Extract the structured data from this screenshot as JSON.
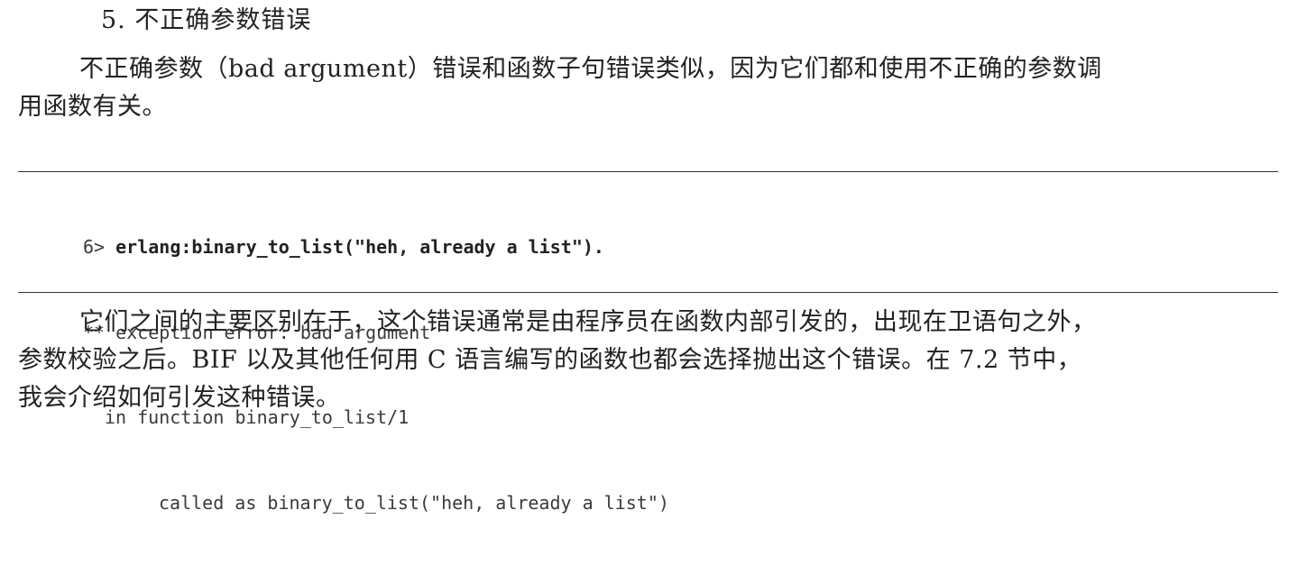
{
  "section": {
    "heading": "5. 不正确参数错误"
  },
  "paragraph1": {
    "line1": "不正确参数（bad argument）错误和函数子句错误类似，因为它们都和使用不正确的参数调",
    "line2": "用函数有关。"
  },
  "code_block": {
    "prompt": "6> ",
    "command": "erlang:binary_to_list(\"heh, already a list\").",
    "line2": "** exception error: bad argument",
    "line3": "in function binary_to_list/1",
    "line4": "called as binary_to_list(\"heh, already a list\")"
  },
  "paragraph2": {
    "line1": "它们之间的主要区别在于，这个错误通常是由程序员在函数内部引发的，出现在卫语句之外，",
    "line2": "参数校验之后。BIF 以及其他任何用 C 语言编写的函数也都会选择抛出这个错误。在 7.2 节中，",
    "line3": "我会介绍如何引发这种错误。"
  }
}
